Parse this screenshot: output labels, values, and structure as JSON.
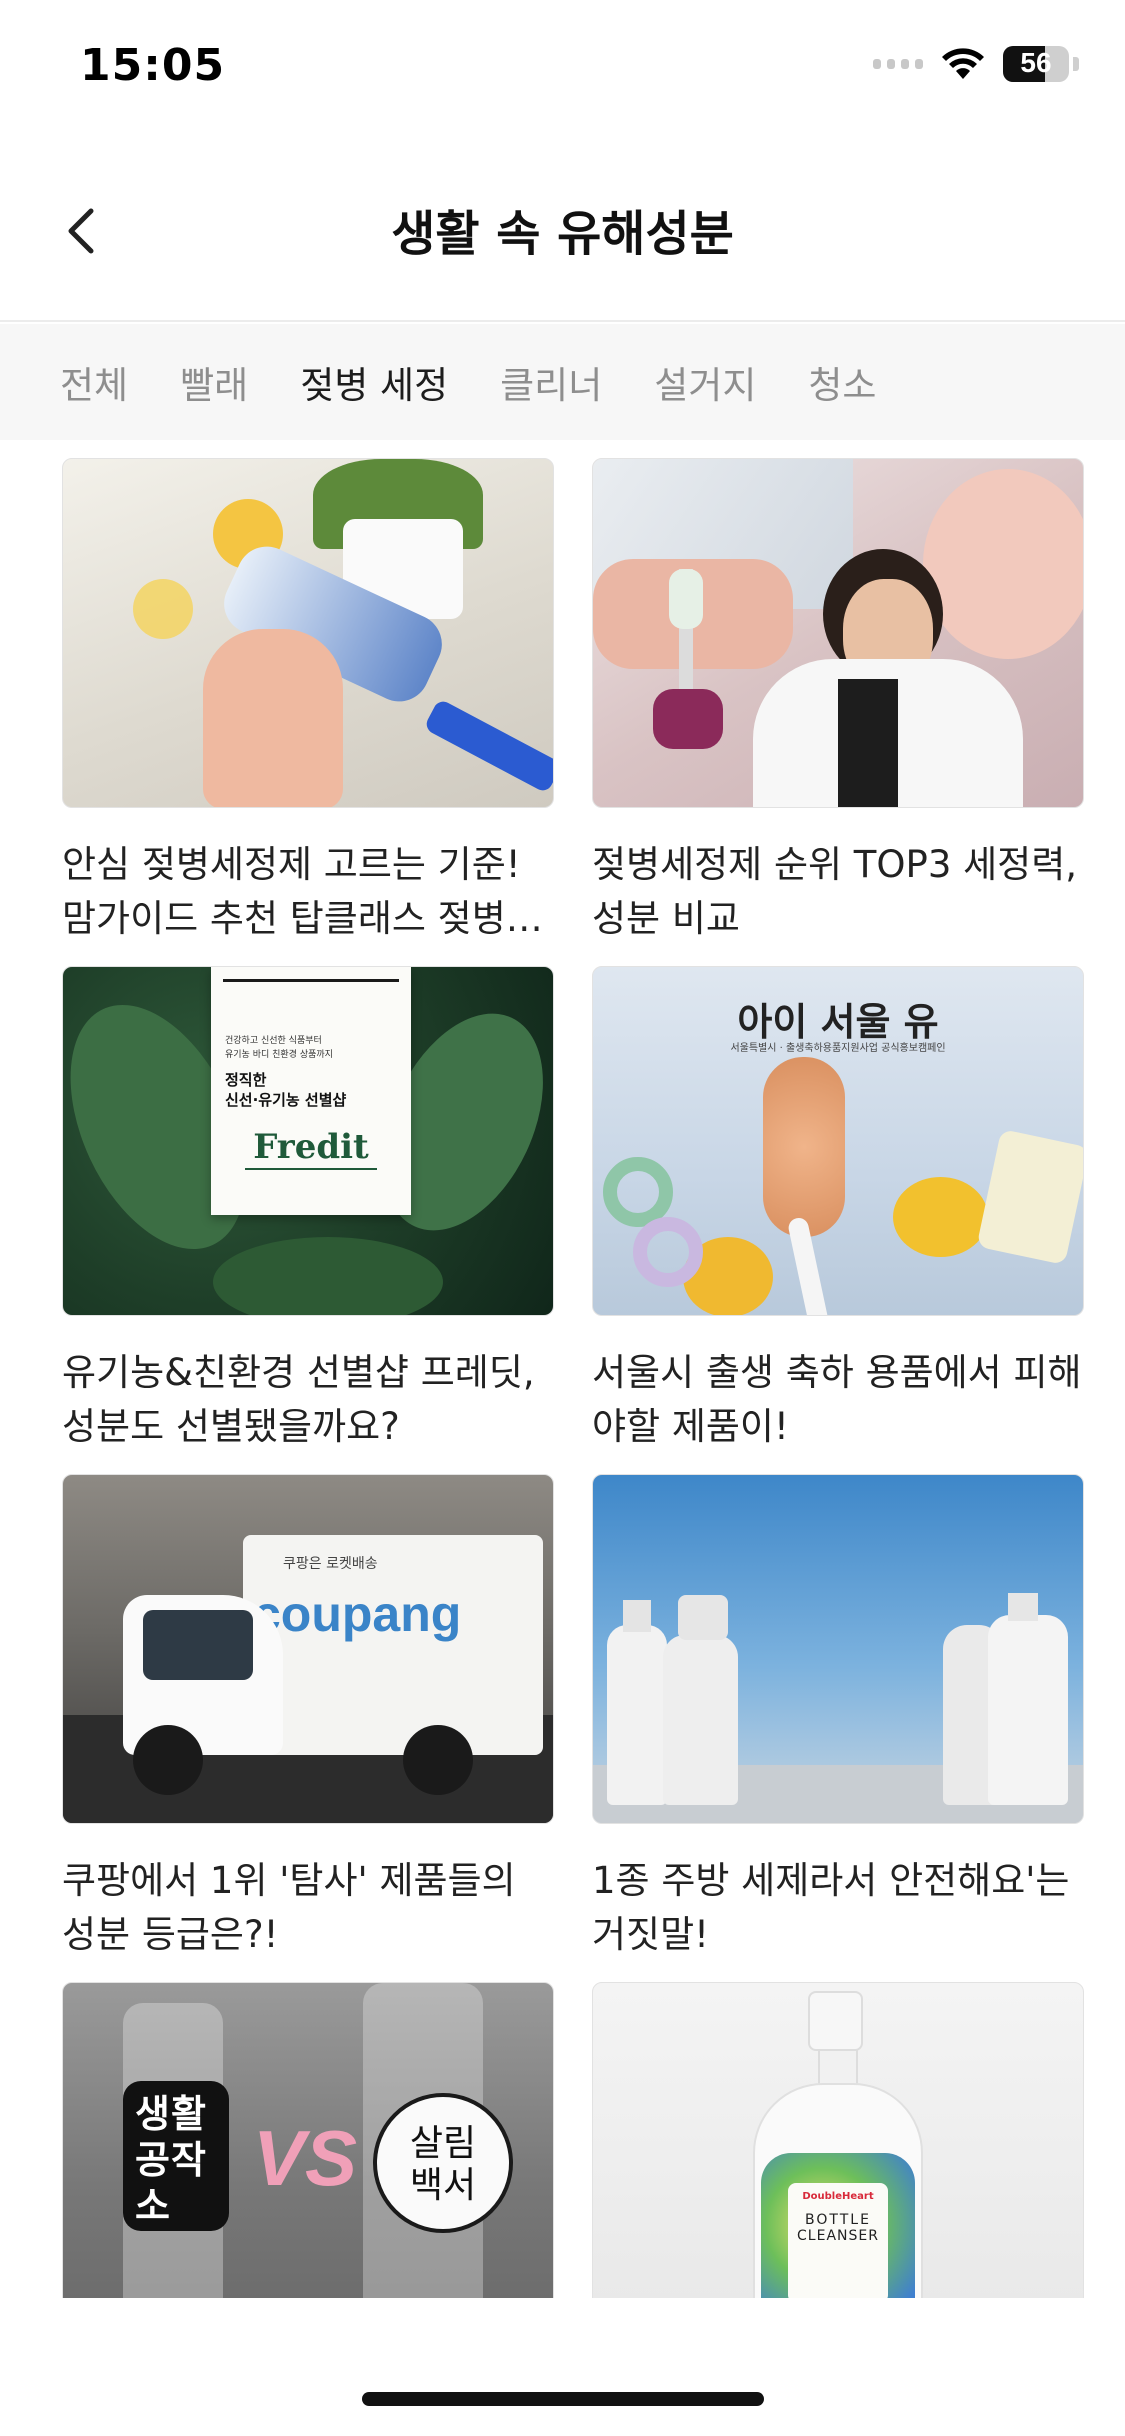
{
  "status_bar": {
    "time": "15:05",
    "battery": "56"
  },
  "header": {
    "title": "생활 속 유해성분"
  },
  "tabs": [
    {
      "label": "전체",
      "active": false
    },
    {
      "label": "빨래",
      "active": false
    },
    {
      "label": "젖병 세정",
      "active": true
    },
    {
      "label": "클리너",
      "active": false
    },
    {
      "label": "설거지",
      "active": false
    },
    {
      "label": "청소",
      "active": false
    }
  ],
  "articles": [
    {
      "title": "안심 젖병세정제 고르는 기준! 맘가이드 추천 탑클래스 젖병세정제"
    },
    {
      "title": "젖병세정제 순위 TOP3 세정력, 성분 비교"
    },
    {
      "title": "유기농&친환경 선별샵 프레딧, 성분도 선별됐을까요?"
    },
    {
      "title": "서울시 출생 축하 용품에서 피해야할 제품이!"
    },
    {
      "title": "쿠팡에서 1위 '탐사' 제품들의 성분 등급은?!"
    },
    {
      "title": "1종 주방 세제라서 안전해요'는 거짓말!"
    },
    {
      "title": ""
    },
    {
      "title": ""
    }
  ],
  "thumbnail_text": {
    "fredit_line1": "건강하고 신선한 식품부터",
    "fredit_line2": "유기농 바디 친환경 상품까지",
    "fredit_heading1": "정직한",
    "fredit_heading2": "신선·유기농 선별샵",
    "fredit_logo": "Fredit",
    "seoul_logo": "아이 서울 유",
    "seoul_sub": "서울특별시 · 출생축하용품지원사업 공식홍보캠페인",
    "coupang_small": "쿠팡은 로켓배송",
    "coupang_logo": "coupang",
    "vs_left": "생활공작소",
    "vs_mid": "VS",
    "vs_right": "살림백서",
    "bottle_brand": "DoubleHeart",
    "bottle_name1": "BOTTLE",
    "bottle_name2": "CLEANSER"
  },
  "icons": {
    "back": "chevron-left-icon",
    "wifi": "wifi-icon",
    "signal": "cellular-signal-icon",
    "battery": "battery-icon"
  },
  "colors": {
    "active_tab": "#1d1d1d",
    "inactive_tab": "#8e8e8e",
    "tab_bar_bg": "#f7f7f7"
  }
}
